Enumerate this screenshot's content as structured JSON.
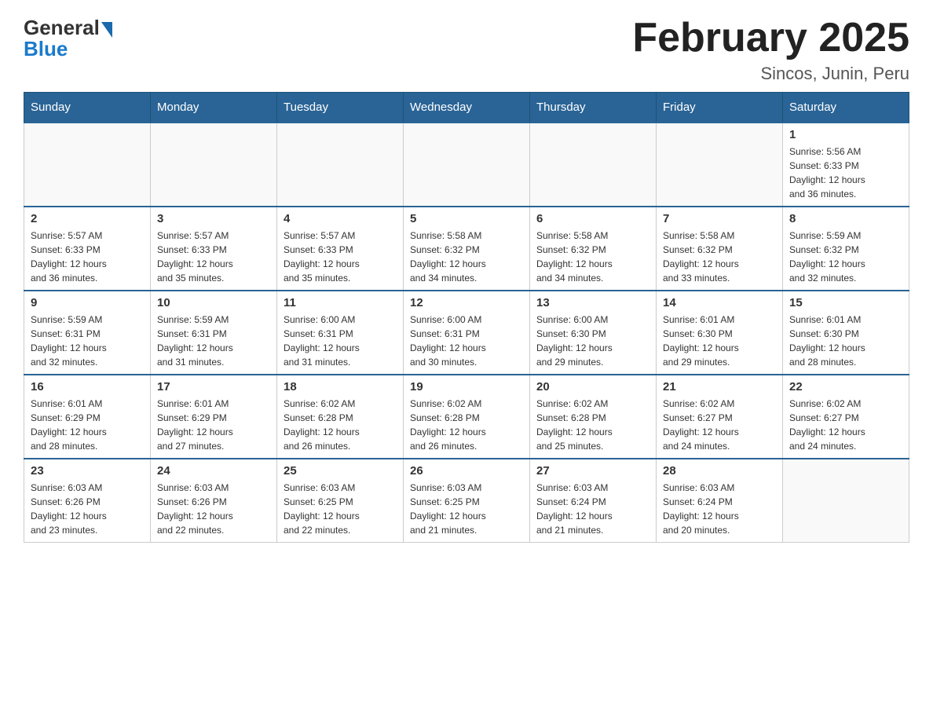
{
  "header": {
    "logo": {
      "general": "General",
      "blue": "Blue"
    },
    "title": "February 2025",
    "subtitle": "Sincos, Junin, Peru"
  },
  "weekdays": [
    "Sunday",
    "Monday",
    "Tuesday",
    "Wednesday",
    "Thursday",
    "Friday",
    "Saturday"
  ],
  "weeks": [
    [
      {
        "day": "",
        "info": ""
      },
      {
        "day": "",
        "info": ""
      },
      {
        "day": "",
        "info": ""
      },
      {
        "day": "",
        "info": ""
      },
      {
        "day": "",
        "info": ""
      },
      {
        "day": "",
        "info": ""
      },
      {
        "day": "1",
        "info": "Sunrise: 5:56 AM\nSunset: 6:33 PM\nDaylight: 12 hours\nand 36 minutes."
      }
    ],
    [
      {
        "day": "2",
        "info": "Sunrise: 5:57 AM\nSunset: 6:33 PM\nDaylight: 12 hours\nand 36 minutes."
      },
      {
        "day": "3",
        "info": "Sunrise: 5:57 AM\nSunset: 6:33 PM\nDaylight: 12 hours\nand 35 minutes."
      },
      {
        "day": "4",
        "info": "Sunrise: 5:57 AM\nSunset: 6:33 PM\nDaylight: 12 hours\nand 35 minutes."
      },
      {
        "day": "5",
        "info": "Sunrise: 5:58 AM\nSunset: 6:32 PM\nDaylight: 12 hours\nand 34 minutes."
      },
      {
        "day": "6",
        "info": "Sunrise: 5:58 AM\nSunset: 6:32 PM\nDaylight: 12 hours\nand 34 minutes."
      },
      {
        "day": "7",
        "info": "Sunrise: 5:58 AM\nSunset: 6:32 PM\nDaylight: 12 hours\nand 33 minutes."
      },
      {
        "day": "8",
        "info": "Sunrise: 5:59 AM\nSunset: 6:32 PM\nDaylight: 12 hours\nand 32 minutes."
      }
    ],
    [
      {
        "day": "9",
        "info": "Sunrise: 5:59 AM\nSunset: 6:31 PM\nDaylight: 12 hours\nand 32 minutes."
      },
      {
        "day": "10",
        "info": "Sunrise: 5:59 AM\nSunset: 6:31 PM\nDaylight: 12 hours\nand 31 minutes."
      },
      {
        "day": "11",
        "info": "Sunrise: 6:00 AM\nSunset: 6:31 PM\nDaylight: 12 hours\nand 31 minutes."
      },
      {
        "day": "12",
        "info": "Sunrise: 6:00 AM\nSunset: 6:31 PM\nDaylight: 12 hours\nand 30 minutes."
      },
      {
        "day": "13",
        "info": "Sunrise: 6:00 AM\nSunset: 6:30 PM\nDaylight: 12 hours\nand 29 minutes."
      },
      {
        "day": "14",
        "info": "Sunrise: 6:01 AM\nSunset: 6:30 PM\nDaylight: 12 hours\nand 29 minutes."
      },
      {
        "day": "15",
        "info": "Sunrise: 6:01 AM\nSunset: 6:30 PM\nDaylight: 12 hours\nand 28 minutes."
      }
    ],
    [
      {
        "day": "16",
        "info": "Sunrise: 6:01 AM\nSunset: 6:29 PM\nDaylight: 12 hours\nand 28 minutes."
      },
      {
        "day": "17",
        "info": "Sunrise: 6:01 AM\nSunset: 6:29 PM\nDaylight: 12 hours\nand 27 minutes."
      },
      {
        "day": "18",
        "info": "Sunrise: 6:02 AM\nSunset: 6:28 PM\nDaylight: 12 hours\nand 26 minutes."
      },
      {
        "day": "19",
        "info": "Sunrise: 6:02 AM\nSunset: 6:28 PM\nDaylight: 12 hours\nand 26 minutes."
      },
      {
        "day": "20",
        "info": "Sunrise: 6:02 AM\nSunset: 6:28 PM\nDaylight: 12 hours\nand 25 minutes."
      },
      {
        "day": "21",
        "info": "Sunrise: 6:02 AM\nSunset: 6:27 PM\nDaylight: 12 hours\nand 24 minutes."
      },
      {
        "day": "22",
        "info": "Sunrise: 6:02 AM\nSunset: 6:27 PM\nDaylight: 12 hours\nand 24 minutes."
      }
    ],
    [
      {
        "day": "23",
        "info": "Sunrise: 6:03 AM\nSunset: 6:26 PM\nDaylight: 12 hours\nand 23 minutes."
      },
      {
        "day": "24",
        "info": "Sunrise: 6:03 AM\nSunset: 6:26 PM\nDaylight: 12 hours\nand 22 minutes."
      },
      {
        "day": "25",
        "info": "Sunrise: 6:03 AM\nSunset: 6:25 PM\nDaylight: 12 hours\nand 22 minutes."
      },
      {
        "day": "26",
        "info": "Sunrise: 6:03 AM\nSunset: 6:25 PM\nDaylight: 12 hours\nand 21 minutes."
      },
      {
        "day": "27",
        "info": "Sunrise: 6:03 AM\nSunset: 6:24 PM\nDaylight: 12 hours\nand 21 minutes."
      },
      {
        "day": "28",
        "info": "Sunrise: 6:03 AM\nSunset: 6:24 PM\nDaylight: 12 hours\nand 20 minutes."
      },
      {
        "day": "",
        "info": ""
      }
    ]
  ]
}
